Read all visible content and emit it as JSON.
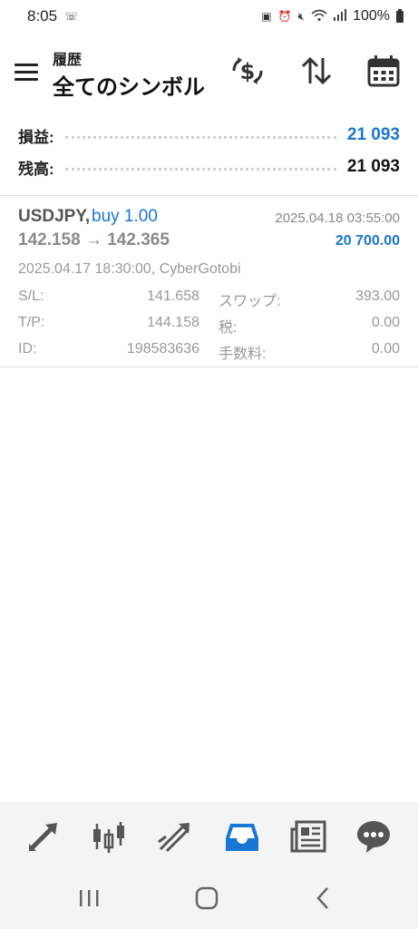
{
  "status": {
    "time": "8:05",
    "battery": "100%"
  },
  "header": {
    "subtitle": "履歴",
    "title": "全てのシンボル"
  },
  "summary": {
    "profit_label": "損益:",
    "profit_value": "21 093",
    "balance_label": "残高:",
    "balance_value": "21 093"
  },
  "trade": {
    "symbol": "USDJPY,",
    "type": "buy 1.00",
    "close_time": "2025.04.18 03:55:00",
    "prices": "142.158 → 142.365",
    "profit": "20 700.00",
    "open_info": "2025.04.17 18:30:00, CyberGotobi",
    "sl_label": "S/L:",
    "sl_value": "141.658",
    "swap_label": "スワップ:",
    "swap_value": "393.00",
    "tp_label": "T/P:",
    "tp_value": "144.158",
    "tax_label": "税:",
    "tax_value": "0.00",
    "id_label": "ID:",
    "id_value": "198583636",
    "fee_label": "手数料:",
    "fee_value": "0.00"
  },
  "tabs": [
    {
      "icon": "quotes-arrows-icon",
      "active": false
    },
    {
      "icon": "candlestick-chart-icon",
      "active": false
    },
    {
      "icon": "trade-icon",
      "active": false
    },
    {
      "icon": "history-inbox-icon",
      "active": true
    },
    {
      "icon": "news-icon",
      "active": false
    },
    {
      "icon": "chat-icon",
      "active": false
    }
  ],
  "colors": {
    "accent": "#1976d2",
    "inactive_icon": "#555555",
    "text_muted": "#999999"
  }
}
